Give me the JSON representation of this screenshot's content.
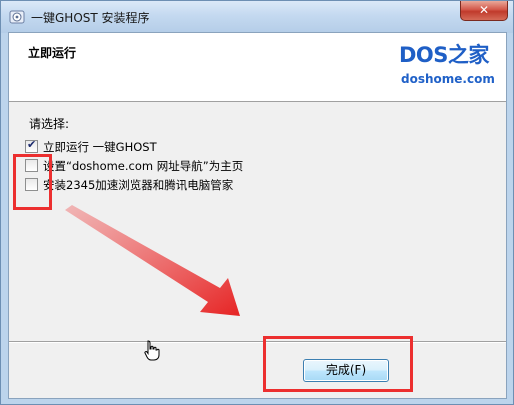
{
  "window": {
    "title": "一键GHOST 安装程序",
    "close_glyph": "✕"
  },
  "header": {
    "title": "立即运行",
    "logo_top": "DOS之家",
    "logo_bottom": "doshome.com"
  },
  "content": {
    "prompt": "请选择:",
    "options": [
      {
        "label": "立即运行 一键GHOST",
        "checked": true
      },
      {
        "label": "设置“doshome.com 网址导航”为主页",
        "checked": false
      },
      {
        "label": "安装2345加速浏览器和腾讯电脑管家",
        "checked": false
      }
    ]
  },
  "footer": {
    "finish_label": "完成(F)"
  },
  "icons": {
    "app": "installer-icon",
    "close": "close-icon",
    "cursor": "hand-cursor-icon",
    "check": "checkmark-icon"
  },
  "colors": {
    "annotation_red": "#ec2f2f",
    "logo_blue": "#1f5fc6",
    "title_bar": "#c4d9f0"
  }
}
